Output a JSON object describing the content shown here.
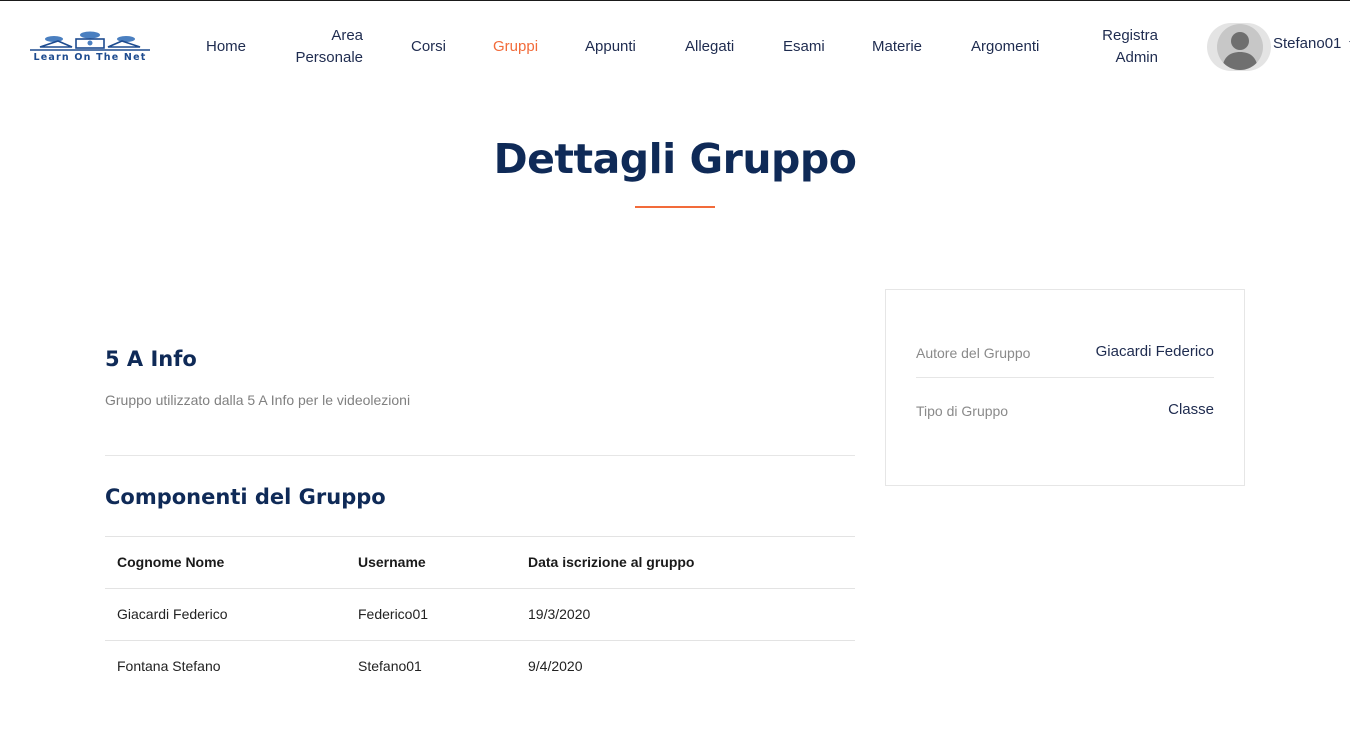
{
  "logo": {
    "text": "Learn On The Net"
  },
  "nav": {
    "items": [
      {
        "label": "Home"
      },
      {
        "line1": "Area",
        "line2": "Personale"
      },
      {
        "label": "Corsi"
      },
      {
        "label": "Gruppi"
      },
      {
        "label": "Appunti"
      },
      {
        "label": "Allegati"
      },
      {
        "label": "Esami"
      },
      {
        "label": "Materie"
      },
      {
        "label": "Argomenti"
      },
      {
        "line1": "Registra",
        "line2": "Admin"
      }
    ],
    "active_index": 3,
    "user_name": "Stefano01",
    "user_icon": "chevron-down-icon"
  },
  "colors": {
    "accent": "#f26b3a",
    "navy": "#0f2a57",
    "text": "#1e2b4f",
    "muted": "#808080"
  },
  "page": {
    "title": "Dettagli Gruppo"
  },
  "group": {
    "name": "5 A Info",
    "description": "Gruppo utilizzato dalla 5 A Info per le videolezioni"
  },
  "members": {
    "title": "Componenti del Gruppo",
    "columns": [
      "Cognome Nome",
      "Username",
      "Data iscrizione al gruppo"
    ],
    "rows": [
      [
        "Giacardi Federico",
        "Federico01",
        "19/3/2020"
      ],
      [
        "Fontana Stefano",
        "Stefano01",
        "9/4/2020"
      ]
    ]
  },
  "info": {
    "author_label": "Autore del Gruppo",
    "author_value": "Giacardi Federico",
    "type_label": "Tipo di Gruppo",
    "type_value": "Classe"
  }
}
